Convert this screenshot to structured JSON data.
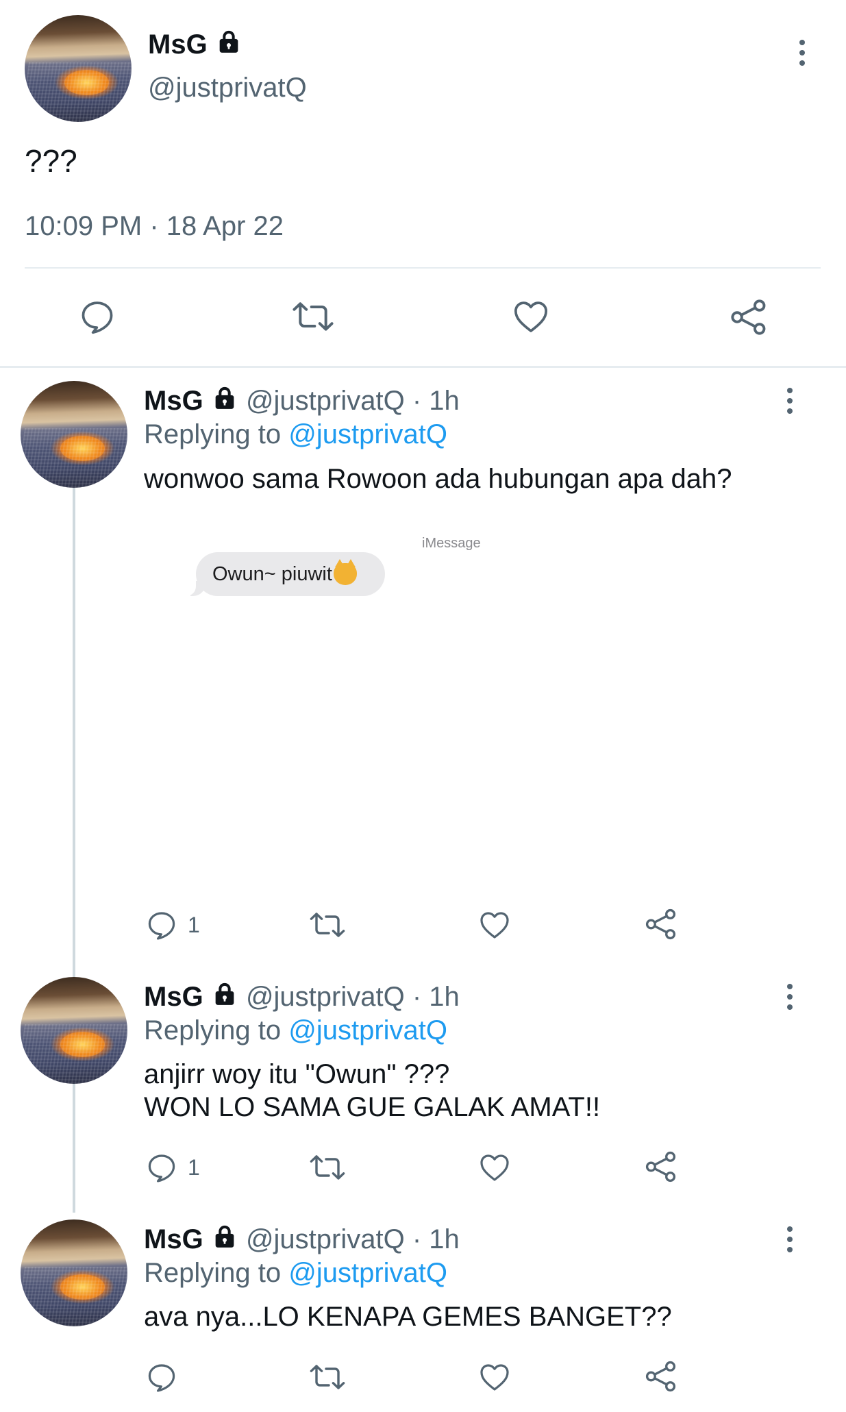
{
  "main_tweet": {
    "display_name": "MsG",
    "handle": "@justprivatQ",
    "text": "???",
    "timestamp": "10:09 PM · 18 Apr 22"
  },
  "replies": [
    {
      "display_name": "MsG",
      "handle_time": "@justprivatQ · 1h",
      "replying_prefix": "Replying to",
      "replying_handle": "@justprivatQ",
      "text_lines": [
        "wonwoo sama Rowoon ada hubungan apa dah?"
      ],
      "media": {
        "app_label": "iMessage",
        "bubble_text": "Owun~ piuwit",
        "emoji": "kissing-cat-emoji"
      },
      "reply_count": "1"
    },
    {
      "display_name": "MsG",
      "handle_time": "@justprivatQ · 1h",
      "replying_prefix": "Replying to",
      "replying_handle": "@justprivatQ",
      "text_lines": [
        "anjirr woy itu \"Owun\" ???",
        "WON LO SAMA GUE GALAK AMAT!!"
      ],
      "reply_count": "1"
    },
    {
      "display_name": "MsG",
      "handle_time": "@justprivatQ · 1h",
      "replying_prefix": "Replying to",
      "replying_handle": "@justprivatQ",
      "text_lines": [
        "ava nya...LO KENAPA GEMES BANGET??"
      ],
      "reply_count": ""
    }
  ],
  "icons": {
    "lock": "lock-icon",
    "more": "more-vertical-icon",
    "reply": "reply-icon",
    "retweet": "retweet-icon",
    "like": "heart-icon",
    "share": "share-icon"
  },
  "colors": {
    "text": "#0f1419",
    "muted": "#536471",
    "link": "#1d9bf0",
    "divider": "#e6ecf0",
    "thread_line": "#cfd9de",
    "bubble": "#e9e9eb"
  }
}
